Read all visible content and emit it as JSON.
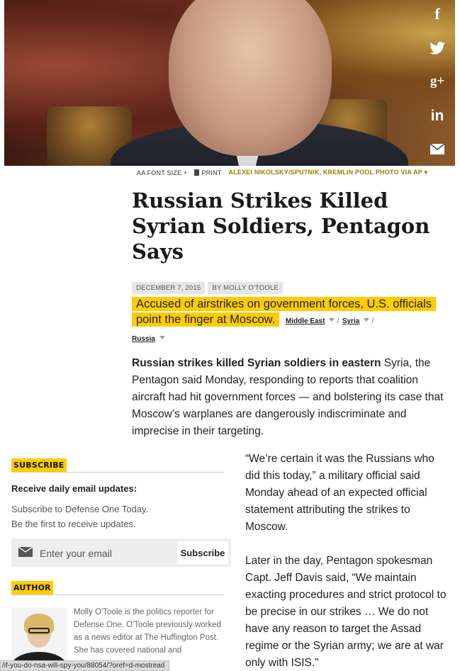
{
  "share": {
    "facebook": "f",
    "googleplus": "g+",
    "linkedin": "in",
    "icons": [
      "facebook-icon",
      "twitter-icon",
      "googleplus-icon",
      "linkedin-icon",
      "email-icon"
    ]
  },
  "toolbar": {
    "font_size": "AA FONT SIZE +",
    "print": "PRINT",
    "credit": "ALEXEI NIKOLSKY/SPUTNIK, KREMLIN POOL PHOTO VIA AP"
  },
  "article": {
    "title": "Russian Strikes Killed Syrian Soldiers, Pentagon Says",
    "date": "DECEMBER 7, 2015",
    "byline": "BY MOLLY O'TOOLE",
    "deck": "Accused of airstrikes on government forces, U.S. officials point the finger at Moscow.",
    "topics": [
      "Middle East",
      "Syria",
      "Russia"
    ],
    "topic_separator": "/",
    "lede_bold": "Russian strikes killed Syrian soldiers in eastern",
    "lede_rest": " Syria, the Pentagon said Monday, responding to reports that coalition aircraft had hit government forces — and bolstering its case that Moscow’s warplanes are dangerously indiscriminate and imprecise in their targeting.",
    "paragraphs": [
      "“We’re certain it was the Russians who did this today,” a military official said Monday ahead of an expected official statement attributing the strikes to Moscow.",
      "Later in the day, Pentagon spokesman Capt. Jeff Davis said, “We maintain exacting procedures and strict protocol to be precise in our strikes … We do not have any reason to target the Assad regime or the Syrian army; we are at war only with ISIS.”"
    ]
  },
  "subscribe": {
    "label": "SUBSCRIBE",
    "heading": "Receive daily email updates:",
    "text_line1": "Subscribe to Defense One Today.",
    "text_line2": "Be the first to receive updates.",
    "placeholder": "Enter your email",
    "button": "Subscribe"
  },
  "author": {
    "label": "AUTHOR",
    "bio": "Molly O'Toole is the politics reporter for Defense One. O'Toole previously worked as a news editor at The Huffington Post. She has covered national and"
  },
  "status_bar": {
    "url": "/if-you-do-nsa-will-spy-you/88054/?oref=d-mostread"
  },
  "colors": {
    "accent": "#ffcc00",
    "credit": "#9b7c00"
  }
}
